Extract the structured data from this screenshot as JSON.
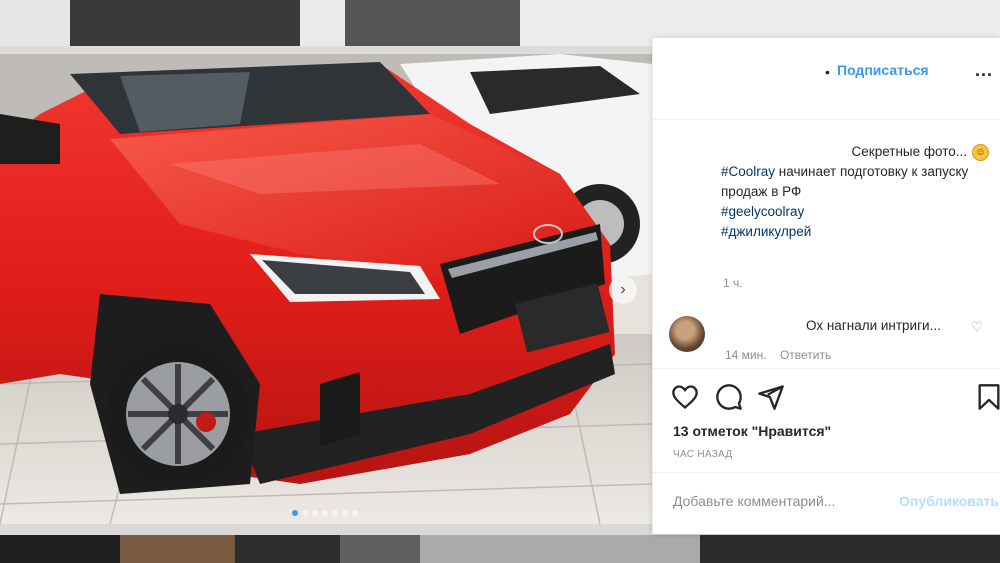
{
  "header": {
    "follow_dot": "•",
    "follow_label": "Подписаться",
    "more": "..."
  },
  "caption": {
    "line1": "Секретные фото...",
    "hashtag1": "#Coolray",
    "text1": " начинает подготовку к запуску продаж в РФ",
    "hashtag2": "#geelycoolray",
    "hashtag3": "#джиликулрей",
    "time": "1 ч."
  },
  "comment": {
    "text": "Ох нагнали интриги...",
    "time": "14 мин.",
    "reply_label": "Ответить"
  },
  "stats": {
    "likes": "13 отметок \"Нравится\"",
    "posted": "ЧАС НАЗАД"
  },
  "add_comment": {
    "placeholder": "Добавьте комментарий...",
    "publish_label": "Опубликовать"
  },
  "icons": {
    "like": "heart-icon",
    "comment": "comment-bubble-icon",
    "share": "paper-plane-icon",
    "save": "bookmark-icon",
    "next": "chevron-right-icon",
    "emoji": "grinning-face-icon"
  },
  "colors": {
    "accent_blue": "#3897f0",
    "hashtag_blue": "#00376b",
    "car_red": "#e8221f"
  },
  "carousel": {
    "slide_count": 7,
    "active_index": 0
  }
}
